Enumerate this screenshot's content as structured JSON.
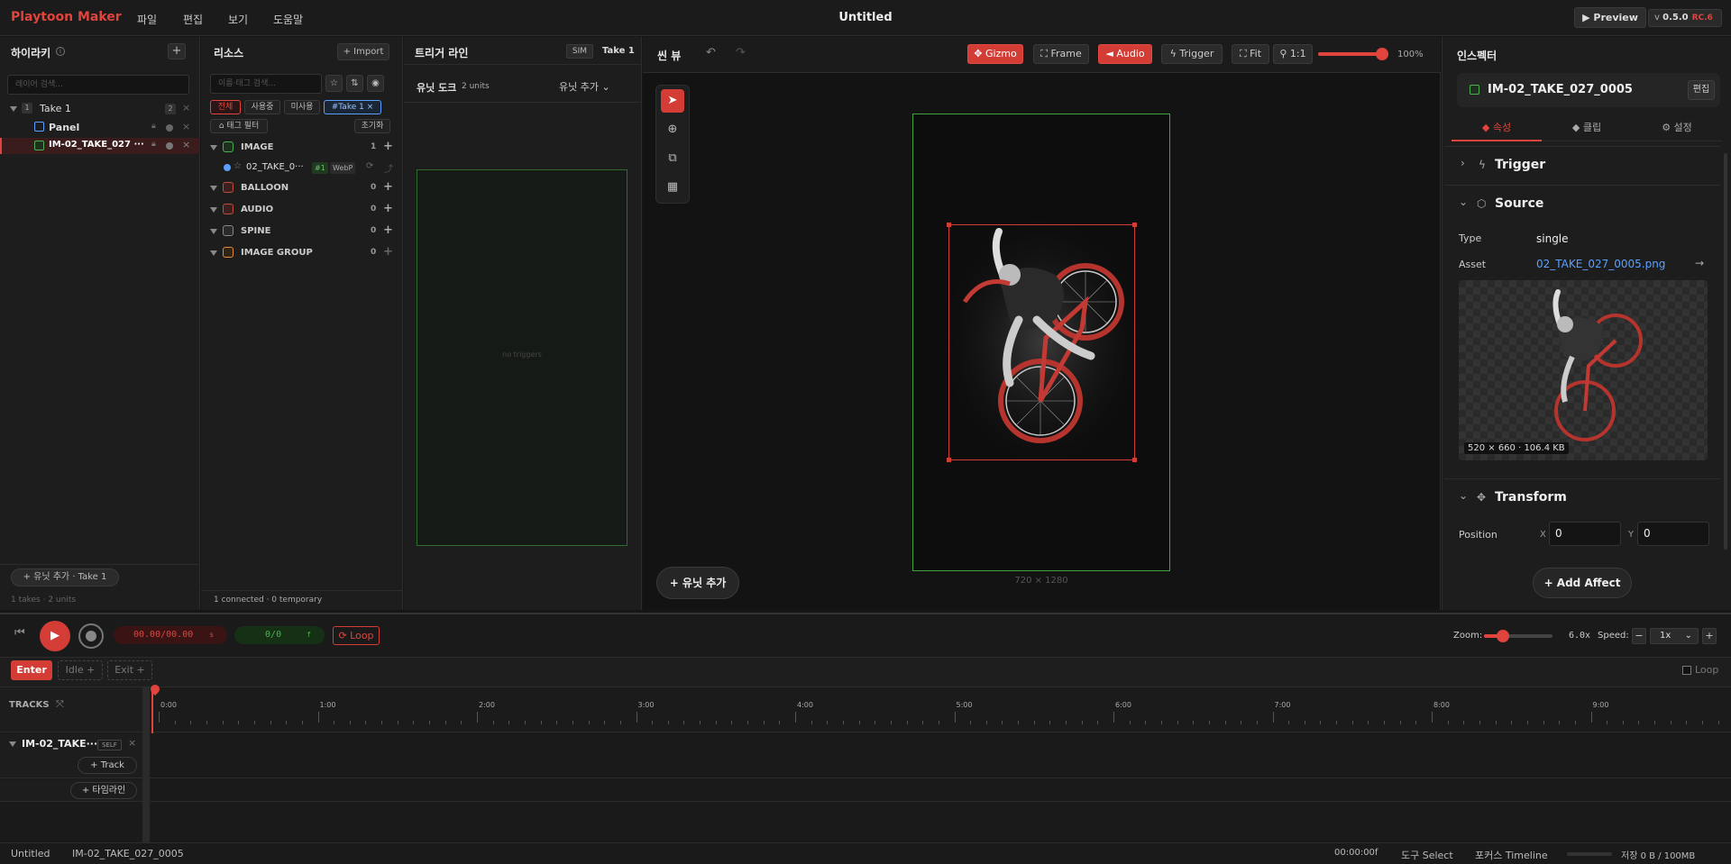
{
  "app": {
    "brand": "Playtoon Maker",
    "menu": [
      "파일",
      "편집",
      "보기",
      "도움말"
    ],
    "title": "Untitled",
    "preview": "▶ Preview",
    "version": "v",
    "version_num": "0.5.0",
    "version_tag": "RC.6"
  },
  "hierarchy": {
    "title": "하이라키",
    "search_placeholder": "레이어 검색...",
    "take": {
      "index": "1",
      "label": "Take 1",
      "count": "2"
    },
    "panel": "Panel",
    "layer": "IM-02_TAKE_027 ···",
    "add_unit": "유닛 추가 · Take 1",
    "footer": "1 takes · 2 units"
  },
  "resources": {
    "title": "리소스",
    "import": "+ Import",
    "search_placeholder": "이름·태그 검색...",
    "filters": [
      "전체",
      "사용중",
      "미사용",
      "#Take 1 ×"
    ],
    "tag_filter": "태그 필터",
    "reset": "초기화",
    "categories": [
      {
        "name": "IMAGE",
        "count": "1"
      },
      {
        "name": "BALLOON",
        "count": "0"
      },
      {
        "name": "AUDIO",
        "count": "0"
      },
      {
        "name": "SPINE",
        "count": "0"
      },
      {
        "name": "IMAGE GROUP",
        "count": "0"
      }
    ],
    "image_item": {
      "name": "02_TAKE_0···",
      "badge": "#1",
      "format": "WebP"
    },
    "footer": "1 connected · 0 temporary"
  },
  "trigger": {
    "title": "트리거 라인",
    "sim": "SIM",
    "take": "Take 1",
    "dock": "유닛 도크",
    "units": "2 units",
    "add_unit": "유닛 추가",
    "empty": "no triggers"
  },
  "scene": {
    "title": "씬 뷰",
    "gizmo": "Gizmo",
    "frame": "Frame",
    "audio": "Audio",
    "trigger": "Trigger",
    "fit": "Fit",
    "ratio": "1:1",
    "zoom": "100%",
    "zoom_value": 1.0,
    "canvas_size": "720 × 1280",
    "add_unit": "+ 유닛 추가"
  },
  "inspector": {
    "title": "인스펙터",
    "object": "IM-02_TAKE_027_0005",
    "edit": "편집",
    "tabs": [
      "속성",
      "클립",
      "설정"
    ],
    "sections": {
      "trigger": "Trigger",
      "source": "Source",
      "transform": "Transform"
    },
    "type_label": "Type",
    "type_value": "single",
    "asset_label": "Asset",
    "asset_value": "02_TAKE_027_0005.png",
    "image_meta": "520 × 660 · 106.4 KB",
    "position_label": "Position",
    "x_label": "X",
    "x_value": "0",
    "y_label": "Y",
    "y_value": "0",
    "add_affect": "Add Affect"
  },
  "timeline": {
    "time": "00.00",
    "time_total": "00.00",
    "time_unit": "s",
    "frame": "0",
    "frame_total": "0",
    "frame_unit": "f",
    "loop_btn": "Loop",
    "zoom_label": "Zoom:",
    "zoom_value": "6.0x",
    "speed_label": "Speed:",
    "speed_value": "1x",
    "phases": [
      "Enter",
      "Idle +",
      "Exit +"
    ],
    "loop_check": "Loop",
    "tracks_label": "TRACKS",
    "ruler": [
      "0:00",
      "1:00",
      "2:00",
      "3:00",
      "4:00",
      "5:00",
      "6:00",
      "7:00",
      "8:00",
      "9:00"
    ],
    "track_name": "IM-02_TAKE···",
    "self_badge": "SELF",
    "add_track": "Track",
    "add_timeline": "타임라인"
  },
  "status": {
    "doc": "Untitled",
    "object": "IM-02_TAKE_027_0005",
    "frame": "00:00:00f",
    "tool": "도구 Select",
    "focus": "포커스 Timeline",
    "storage": "저장 0 B / 100MB"
  },
  "colors": {
    "accent": "#e0443c",
    "blue": "#5aa0ff",
    "green": "#4caf50"
  }
}
